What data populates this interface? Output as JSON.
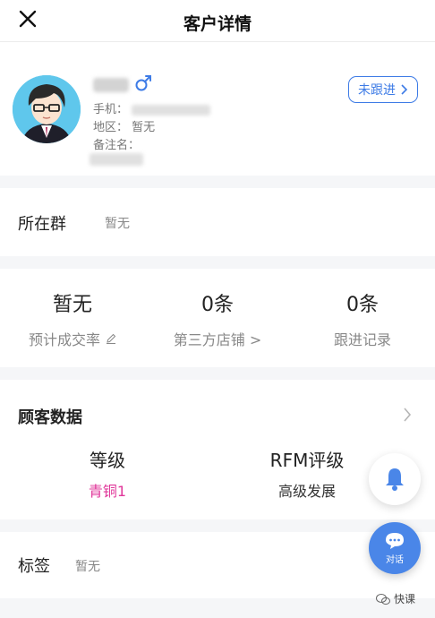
{
  "header": {
    "title": "客户详情",
    "close_icon": "close-icon"
  },
  "profile": {
    "gender_symbol": "♂",
    "phone_label": "手机：",
    "region_label": "地区：",
    "region_value": "暂无",
    "note_label": "备注名：",
    "follow_button": "未跟进"
  },
  "group": {
    "label": "所在群",
    "value": "暂无"
  },
  "stats": [
    {
      "value": "暂无",
      "label": "预计成交率"
    },
    {
      "value": "0条",
      "label": "第三方店铺 >"
    },
    {
      "value": "0条",
      "label": "跟进记录"
    }
  ],
  "customer_data": {
    "title": "顾客数据",
    "level_title": "等级",
    "level_value": "青铜1",
    "rfm_title": "RFM评级",
    "rfm_value": "高级发展"
  },
  "tags": {
    "label": "标签",
    "value": "暂无"
  },
  "fab": {
    "chat_label": "对话"
  },
  "watermark": {
    "text": "快课"
  },
  "colors": {
    "accent": "#3d7be6",
    "level_pink": "#e0379a",
    "fab_blue": "#4a86e8"
  }
}
